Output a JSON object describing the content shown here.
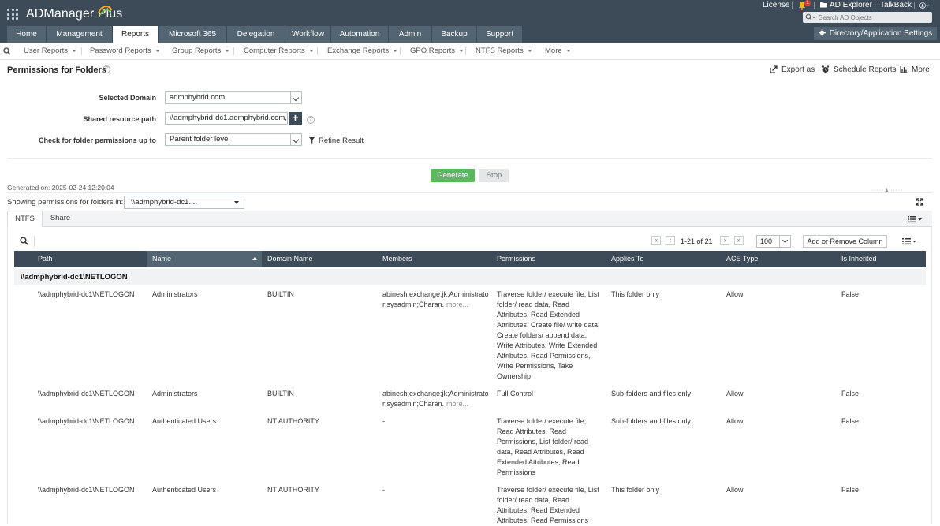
{
  "app": {
    "name": "ADManager Plus"
  },
  "top_links": {
    "license": "License",
    "notification_count": "1",
    "ad_explorer": "AD Explorer",
    "talkback": "TalkBack"
  },
  "search": {
    "placeholder": "Search AD Objects"
  },
  "main_tabs": [
    "Home",
    "Management",
    "Reports",
    "Microsoft 365",
    "Delegation",
    "Workflow",
    "Automation",
    "Admin",
    "Backup",
    "Support"
  ],
  "active_tab": "Reports",
  "dir_settings": "Directory/Application Settings",
  "sub_nav": [
    "User Reports",
    "Password Reports",
    "Group Reports",
    "Computer Reports",
    "Exchange Reports",
    "GPO Reports",
    "NTFS Reports",
    "More"
  ],
  "page": {
    "title": "Permissions for Folders",
    "actions": {
      "export": "Export as",
      "schedule": "Schedule Reports",
      "more": "More"
    }
  },
  "form": {
    "domain_label": "Selected Domain",
    "domain_value": "admphybrid.com",
    "path_label": "Shared resource path",
    "path_value": "\\\\admphybrid-dc1.admphybrid.com,",
    "level_label": "Check for folder permissions up to",
    "level_value": "Parent folder level",
    "refine": "Refine Result",
    "generate": "Generate",
    "stop": "Stop"
  },
  "result": {
    "generated_on": "Generated on: 2025-02-24 12:20:04",
    "showing_label": "Showing permissions for folders in:",
    "showing_value": "\\\\admphybrid-dc1....",
    "inner_tabs": [
      "NTFS",
      "Share"
    ],
    "pager": "1-21 of 21",
    "per_page": "100",
    "add_remove": "Add or Remove Column"
  },
  "table": {
    "columns": [
      "Path",
      "Name",
      "Domain Name",
      "Members",
      "Permissions",
      "Applies To",
      "ACE Type",
      "Is Inherited"
    ],
    "sorted_column": "Name",
    "group": "\\\\admphybrid-dc1\\NETLOGON",
    "more_text": "more...",
    "rows": [
      {
        "path": "\\\\admphybrid-dc1\\NETLOGON",
        "name": "Administrators",
        "domain": "BUILTIN",
        "members": "abinesh;exchange;jk;Administrator;sysadmin;Charan.",
        "members_more": true,
        "permissions": "Traverse folder/ execute file, List folder/ read data, Read Attributes, Read Extended Attributes, Create file/ write data, Create folders/ append data, Write Attributes, Write Extended Attributes, Read Permissions, Write Permissions, Take Ownership",
        "applies": "This folder only",
        "ace": "Allow",
        "inherited": "False"
      },
      {
        "path": "\\\\admphybrid-dc1\\NETLOGON",
        "name": "Administrators",
        "domain": "BUILTIN",
        "members": "abinesh;exchange;jk;Administrator;sysadmin;Charan.",
        "members_more": true,
        "permissions": "Full Control",
        "applies": "Sub-folders and files only",
        "ace": "Allow",
        "inherited": "False"
      },
      {
        "path": "\\\\admphybrid-dc1\\NETLOGON",
        "name": "Authenticated Users",
        "domain": "NT AUTHORITY",
        "members": "-",
        "members_more": false,
        "permissions": "Traverse folder/ execute file, Read Attributes, Read Permissions, List folder/ read data, Read Attributes, Read Extended Attributes, Read Permissions",
        "applies": "Sub-folders and files only",
        "ace": "Allow",
        "inherited": "False"
      },
      {
        "path": "\\\\admphybrid-dc1\\NETLOGON",
        "name": "Authenticated Users",
        "domain": "NT AUTHORITY",
        "members": "-",
        "members_more": false,
        "permissions": "Traverse folder/ execute file, List folder/ read data, Read Attributes, Read Extended Attributes, Read Permissions",
        "applies": "This folder only",
        "ace": "Allow",
        "inherited": "False"
      }
    ]
  },
  "colors": {
    "header_bg": "#3c4b57",
    "tab_bg": "#536572",
    "generate_green": "#5cb85c",
    "badge_red": "#e23b2e"
  }
}
